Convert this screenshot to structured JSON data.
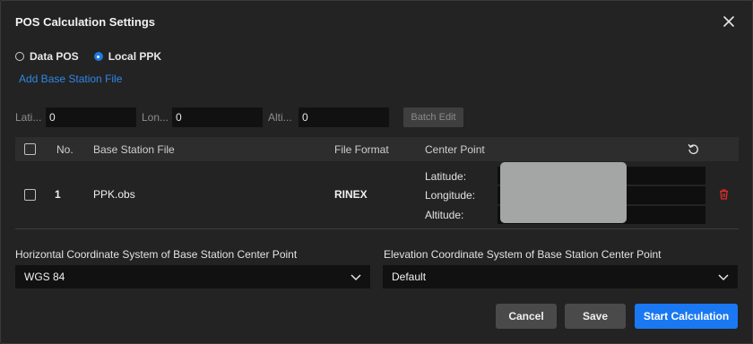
{
  "dialog": {
    "title": "POS Calculation Settings"
  },
  "mode": {
    "options": [
      {
        "label": "Data POS",
        "selected": false
      },
      {
        "label": "Local PPK",
        "selected": true
      }
    ]
  },
  "add_link": "Add Base Station File",
  "batch": {
    "latitude_label": "Lati...",
    "latitude_value": "0",
    "longitude_label": "Lon...",
    "longitude_value": "0",
    "altitude_label": "Alti...",
    "altitude_value": "0",
    "edit_label": "Batch Edit"
  },
  "table": {
    "headers": {
      "no": "No.",
      "file": "Base Station File",
      "format": "File Format",
      "center": "Center Point"
    },
    "rows": [
      {
        "no": "1",
        "file": "PPK.obs",
        "format": "RINEX",
        "lat_label": "Latitude:",
        "lon_label": "Longitude:",
        "alt_label": "Altitude:"
      }
    ]
  },
  "horizontal": {
    "label": "Horizontal Coordinate System of Base Station Center Point",
    "value": "WGS 84"
  },
  "elevation": {
    "label": "Elevation Coordinate System of Base Station Center Point",
    "value": "Default"
  },
  "buttons": {
    "cancel": "Cancel",
    "save": "Save",
    "start": "Start Calculation"
  },
  "colors": {
    "accent": "#1a78f2",
    "link": "#2f86e6",
    "delete": "#e02b2b",
    "background": "#232323"
  },
  "icons": [
    "close-icon",
    "reset-icon",
    "delete-icon",
    "chevron-down-icon"
  ]
}
